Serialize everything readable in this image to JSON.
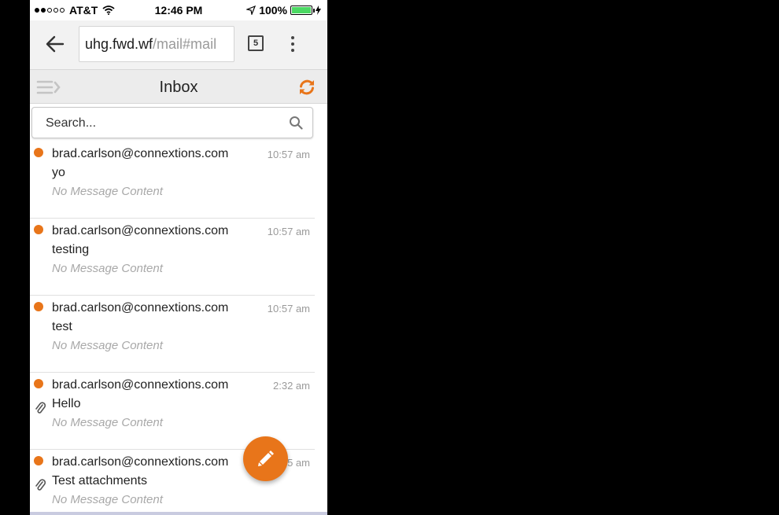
{
  "status_bar": {
    "carrier": "AT&T",
    "time": "12:46 PM",
    "battery": "100%",
    "battery_level": 1.0,
    "signal_bars_filled": 2,
    "signal_bars_total": 5
  },
  "browser": {
    "url_host": "uhg.fwd.wf",
    "url_path": "/mail#mail",
    "tab_count": "5"
  },
  "header": {
    "title": "Inbox"
  },
  "search": {
    "placeholder": "Search..."
  },
  "messages": [
    {
      "sender": "brad.carlson@connextions.com",
      "subject": "yo",
      "preview": "No Message Content",
      "time": "10:57 am",
      "unread": true,
      "attachment": false
    },
    {
      "sender": "brad.carlson@connextions.com",
      "subject": "testing",
      "preview": "No Message Content",
      "time": "10:57 am",
      "unread": true,
      "attachment": false
    },
    {
      "sender": "brad.carlson@connextions.com",
      "subject": "test",
      "preview": "No Message Content",
      "time": "10:57 am",
      "unread": true,
      "attachment": false
    },
    {
      "sender": "brad.carlson@connextions.com",
      "subject": "Hello",
      "preview": "No Message Content",
      "time": "2:32 am",
      "unread": true,
      "attachment": true
    },
    {
      "sender": "brad.carlson@connextions.com",
      "subject": "Test attachments",
      "preview": "No Message Content",
      "time": "5 am",
      "unread": true,
      "attachment": true
    }
  ],
  "icons": {
    "back": "arrow-left-icon",
    "menu": "more-vertical-icon",
    "sidebar": "sidebar-toggle-icon",
    "refresh": "refresh-icon",
    "search": "search-icon",
    "attachment": "paperclip-icon",
    "compose": "pencil-icon"
  },
  "colors": {
    "accent": "#e8751a",
    "unread_dot": "#e8751a",
    "battery_fill": "#4cd964"
  }
}
